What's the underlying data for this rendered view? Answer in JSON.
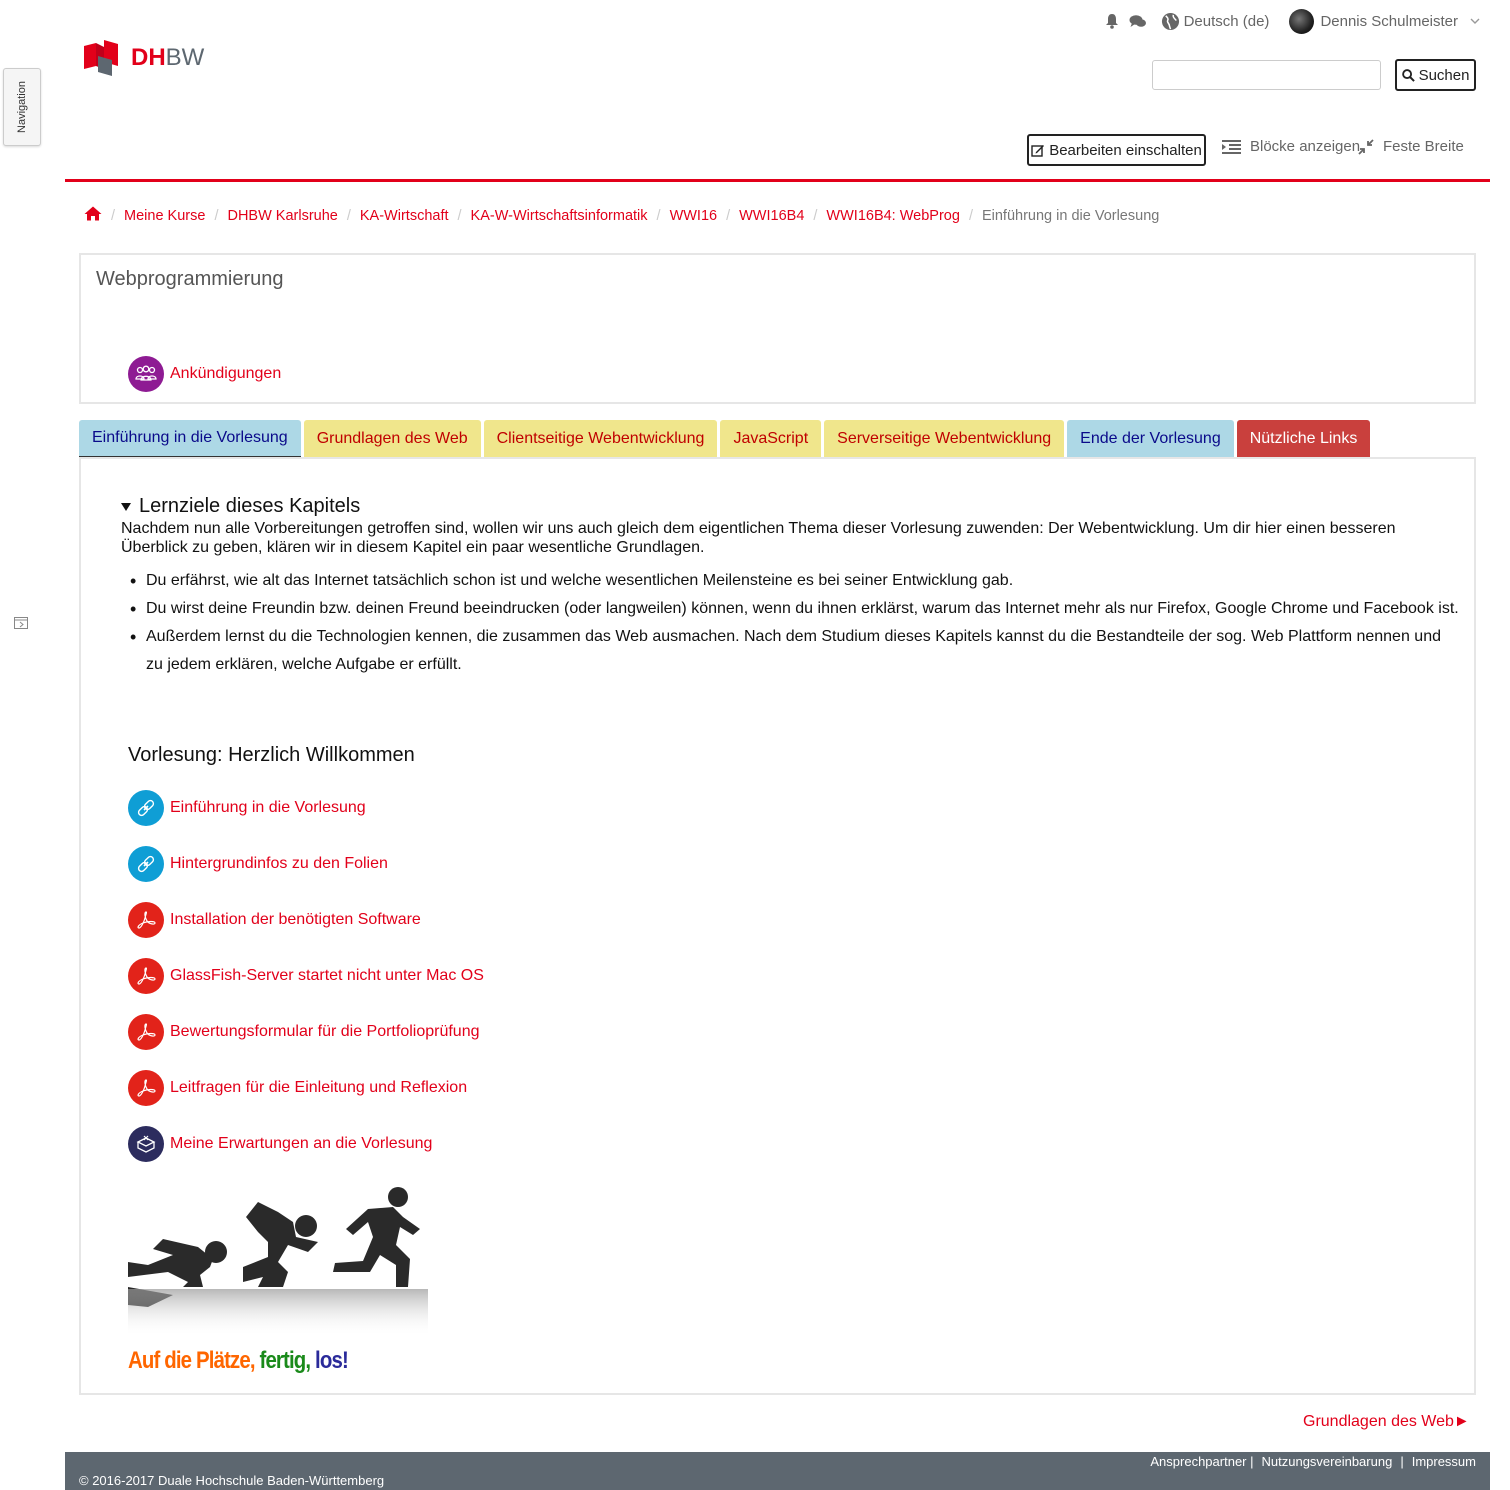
{
  "nav_drawer": {
    "label": "Navigation"
  },
  "topbar": {
    "language": "Deutsch (de)",
    "user_name": "Dennis Schulmeister"
  },
  "logo": {
    "dh": "DH",
    "bw": "BW"
  },
  "search": {
    "button_label": "Suchen",
    "value": ""
  },
  "toolbar": {
    "edit_label": "Bearbeiten einschalten",
    "blocks_label": "Blöcke anzeigen",
    "fixed_width_label": "Feste Breite"
  },
  "breadcrumb": [
    "Meine Kurse",
    "DHBW Karlsruhe",
    "KA-Wirtschaft",
    "KA-W-Wirtschaftsinformatik",
    "WWI16",
    "WWI16B4",
    "WWI16B4: WebProg",
    "Einführung in die Vorlesung"
  ],
  "course": {
    "title": "Webprogrammierung",
    "announcements": "Ankündigungen"
  },
  "tabs": [
    {
      "label": "Einführung in die Vorlesung",
      "color": "#add8e6"
    },
    {
      "label": "Grundlagen des Web",
      "color": "#f0e68c"
    },
    {
      "label": "Clientseitige Webentwicklung",
      "color": "#f0e68c"
    },
    {
      "label": "JavaScript",
      "color": "#f0e68c"
    },
    {
      "label": "Serverseitige Webentwicklung",
      "color": "#f0e68c"
    },
    {
      "label": "Ende der Vorlesung",
      "color": "#add8e6"
    },
    {
      "label": "Nützliche Links",
      "color": "#c9403d"
    }
  ],
  "goals": {
    "heading": "Lernziele dieses Kapitels",
    "intro": "Nachdem nun alle Vorbereitungen getroffen sind, wollen wir uns auch gleich dem eigentlichen Thema dieser Vorlesung zuwenden: Der Webentwicklung. Um dir hier einen besseren Überblick zu geben, klären wir in diesem Kapitel ein paar wesentliche Grundlagen.",
    "items": [
      "Du erfährst, wie alt das Internet tatsächlich schon ist und welche wesentlichen Meilensteine es bei seiner Entwicklung gab.",
      "Du wirst deine Freundin bzw. deinen Freund beeindrucken (oder langweilen) können, wenn du ihnen erklärst, warum das Internet mehr als nur Firefox, Google Chrome und Facebook ist.",
      "Außerdem lernst du die Technologien kennen, die zusammen das Web ausmachen. Nach dem Studium dieses Kapitels kannst du die Bestandteile der sog. Web Plattform nennen und zu jedem erklären, welche Aufgabe er erfüllt."
    ]
  },
  "section": {
    "title": "Vorlesung: Herzlich Willkommen",
    "activities": [
      {
        "label": "Einführung in die Vorlesung",
        "icon": "url-icon"
      },
      {
        "label": "Hintergrundinfos zu den Folien",
        "icon": "url-icon"
      },
      {
        "label": "Installation der benötigten Software",
        "icon": "pdf-icon"
      },
      {
        "label": "GlassFish-Server startet nicht unter Mac OS",
        "icon": "pdf-icon"
      },
      {
        "label": "Bewertungsformular für die Portfolioprüfung",
        "icon": "pdf-icon"
      },
      {
        "label": "Leitfragen für die Einleitung und Reflexion",
        "icon": "pdf-icon"
      },
      {
        "label": "Meine Erwartungen an die Vorlesung",
        "icon": "feedback-icon"
      }
    ],
    "slogan": {
      "part1": "Auf die Plätze,",
      "part2": "fertig,",
      "part3": "los!"
    }
  },
  "next_link": "Grundlagen des Web►",
  "footer": {
    "links": [
      "Ansprechpartner |",
      "Nutzungsvereinbarung",
      "|",
      "Impressum"
    ],
    "copyright": "© 2016-2017 Duale Hochschule Baden-Württemberg"
  },
  "colors": {
    "brand_red": "#e2001a",
    "footer_bg": "#5d6770",
    "url_icon": "#0f9ed5",
    "pdf_icon": "#e2231a",
    "forum_icon": "#8e1b93",
    "feedback_icon": "#2c2c5e"
  }
}
